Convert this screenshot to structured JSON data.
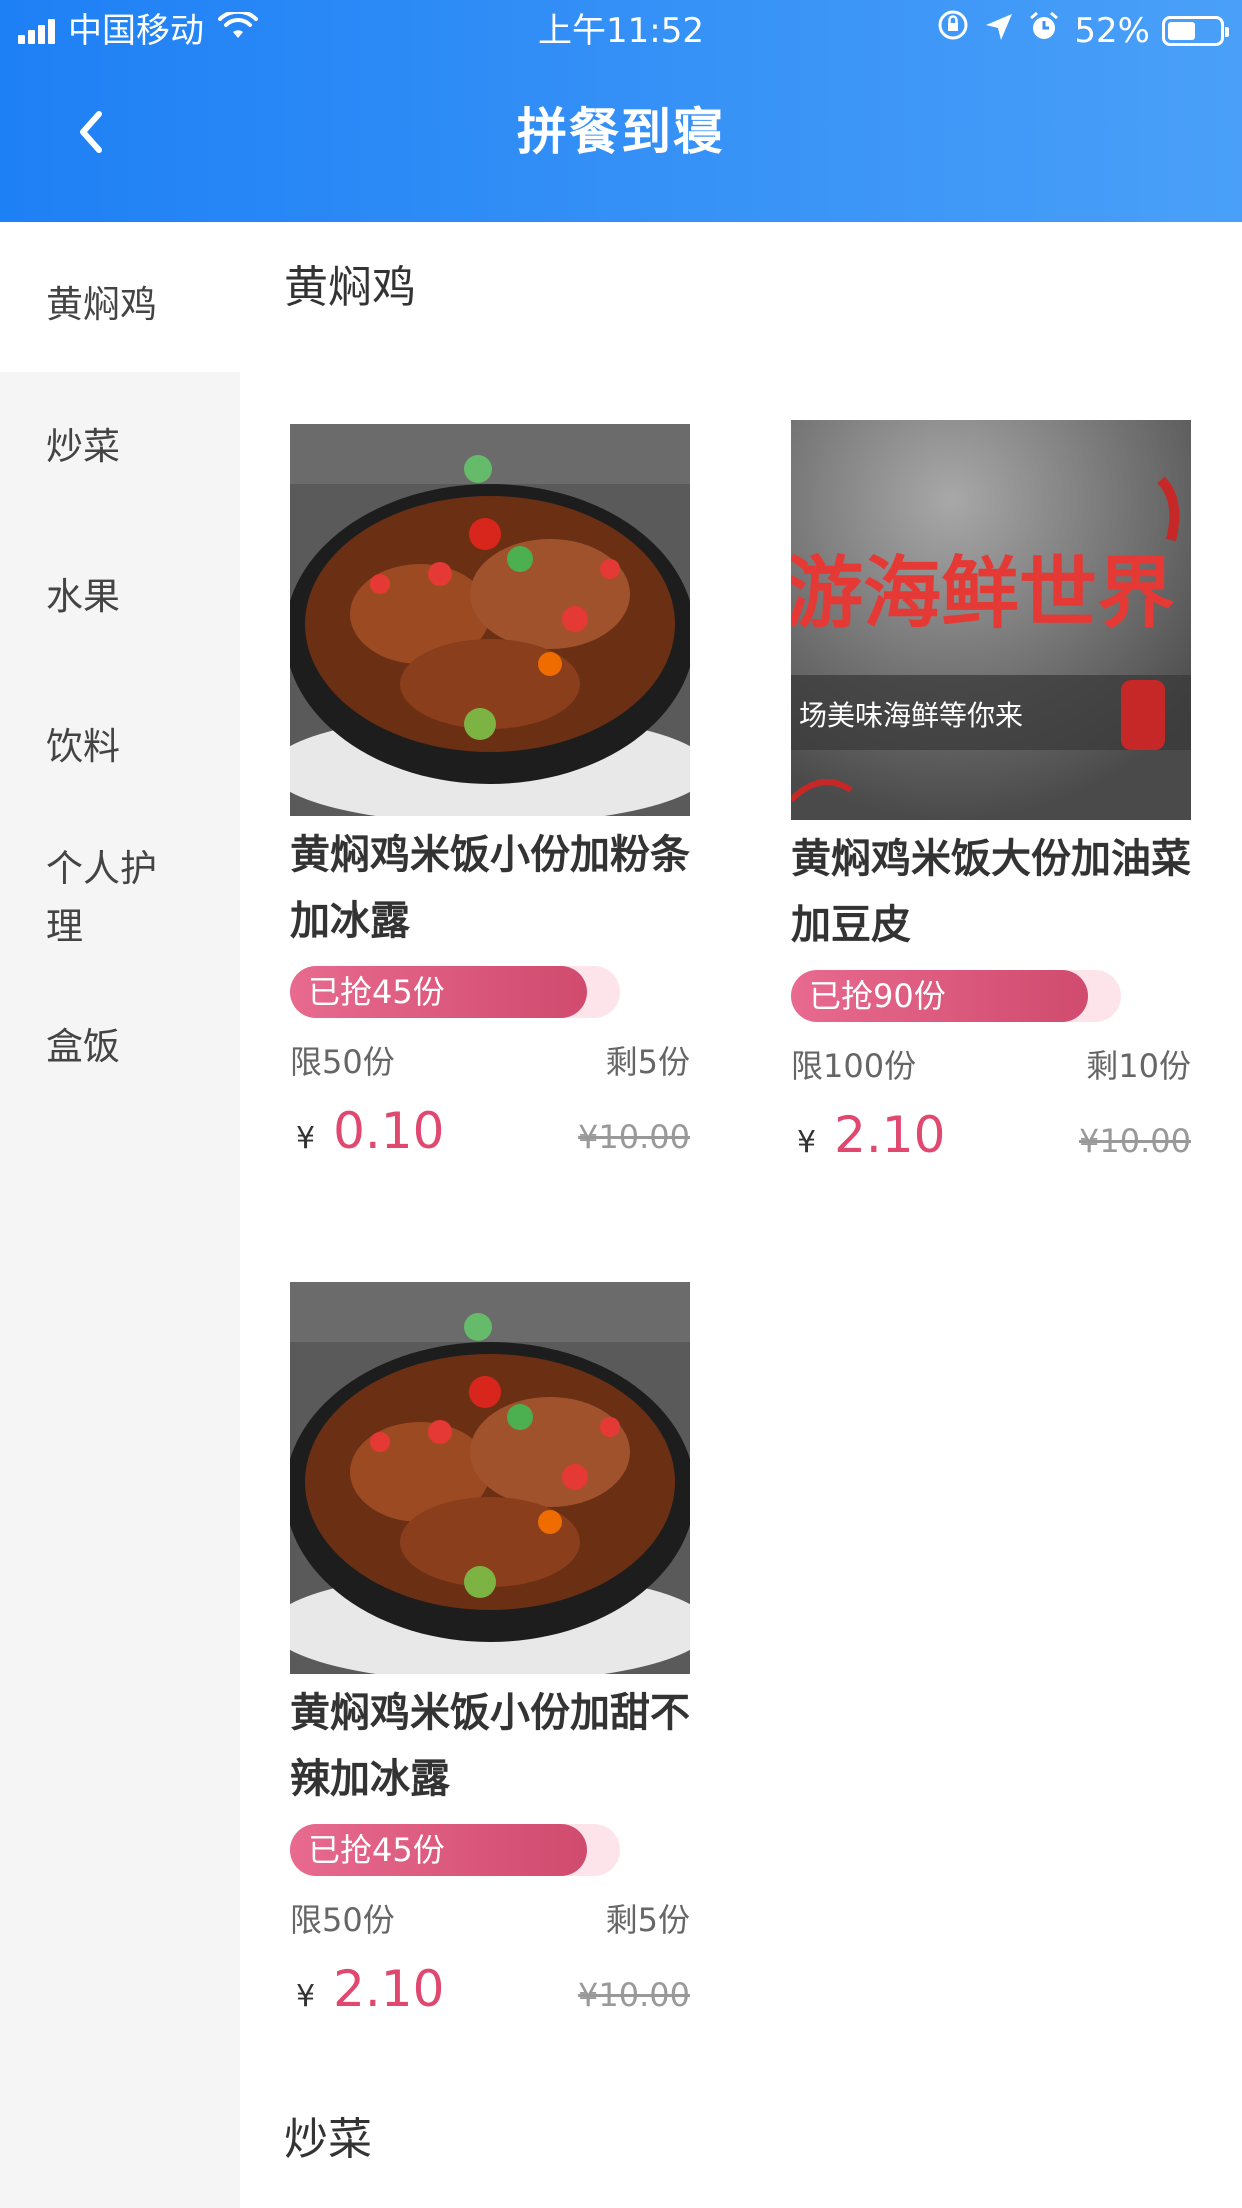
{
  "status_bar": {
    "carrier": "中国移动",
    "time": "上午11:52",
    "battery": "52%",
    "battery_level": 0.52
  },
  "nav": {
    "title": "拼餐到寝",
    "back_icon": "chevron-left-icon"
  },
  "sidebar": {
    "items": [
      {
        "label": "黄焖鸡",
        "active": true
      },
      {
        "label": "炒菜"
      },
      {
        "label": "水果"
      },
      {
        "label": "饮料"
      },
      {
        "label": "个人护理"
      },
      {
        "label": "盒饭"
      }
    ]
  },
  "sections": [
    {
      "title": "黄焖鸡",
      "products": [
        {
          "name": "黄焖鸡米饭小份加粉条加冰露",
          "sold": "已抢45份",
          "sold_fraction": 0.9,
          "limit": "限50份",
          "remaining": "剩5份",
          "currency": "¥",
          "price": "0.10",
          "original_price": "¥10.00",
          "image": "braised-chicken-photo"
        },
        {
          "name": "黄焖鸡米饭大份加油菜加豆皮",
          "sold": "已抢90份",
          "sold_fraction": 0.9,
          "limit": "限100份",
          "remaining": "剩10份",
          "currency": "¥",
          "price": "2.10",
          "original_price": "¥10.00",
          "image": "seafood-banner",
          "image_text": "游海鲜世界",
          "image_subtext": "场美味海鲜等你来"
        },
        {
          "name": "黄焖鸡米饭小份加甜不辣加冰露",
          "sold": "已抢45份",
          "sold_fraction": 0.9,
          "limit": "限50份",
          "remaining": "剩5份",
          "currency": "¥",
          "price": "2.10",
          "original_price": "¥10.00",
          "image": "braised-chicken-photo"
        }
      ]
    },
    {
      "title": "炒菜",
      "products": []
    }
  ],
  "colors": {
    "header_start": "#1e80f5",
    "header_end": "#4aa0f8",
    "accent_price": "#e0486f",
    "progress": "#d04b6e",
    "sidebar_bg": "#f5f5f5"
  }
}
